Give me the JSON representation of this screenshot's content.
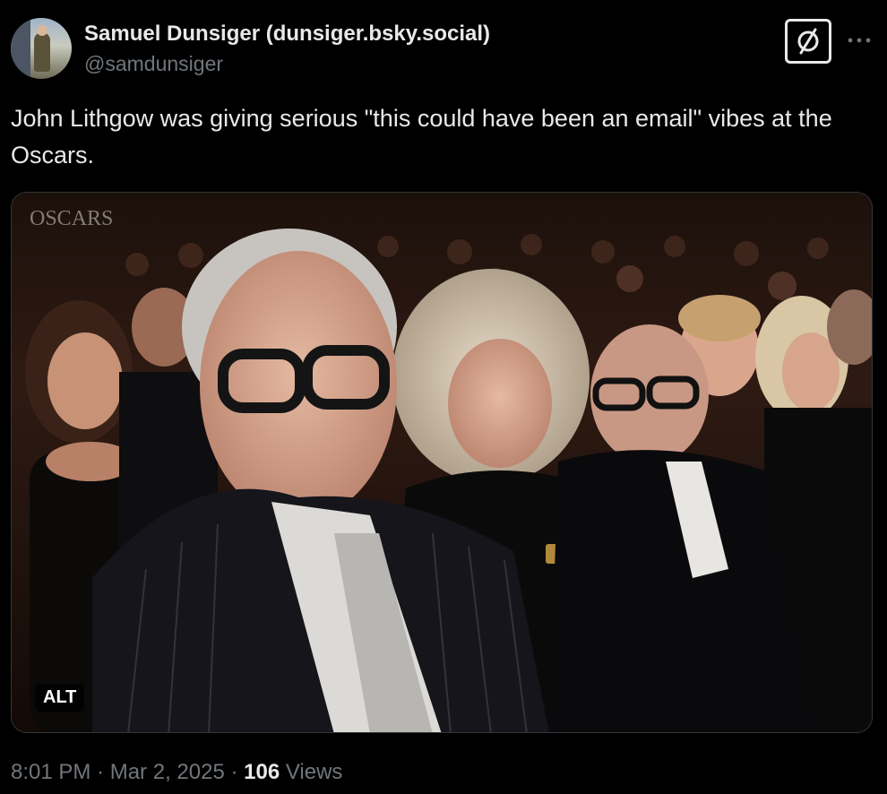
{
  "author": {
    "display_name": "Samuel Dunsiger (dunsiger.bsky.social)",
    "handle": "@samdunsiger",
    "avatar_icon": "avatar-photo"
  },
  "header_actions": {
    "follow_icon": "circle-slash-icon",
    "more_icon": "more-horizontal-icon"
  },
  "post": {
    "text": "John Lithgow was giving serious \"this could have been an email\" vibes at the Oscars."
  },
  "media": {
    "watermark": "OSCARS",
    "alt_badge": "ALT"
  },
  "meta": {
    "time": "8:01 PM",
    "separator_1": " · ",
    "date": "Mar 2, 2025",
    "separator_2": " · ",
    "views_count": "106",
    "views_label": " Views"
  },
  "colors": {
    "background": "#000000",
    "primary_text": "#e7e9ea",
    "secondary_text": "#71767b",
    "border": "#333639"
  }
}
